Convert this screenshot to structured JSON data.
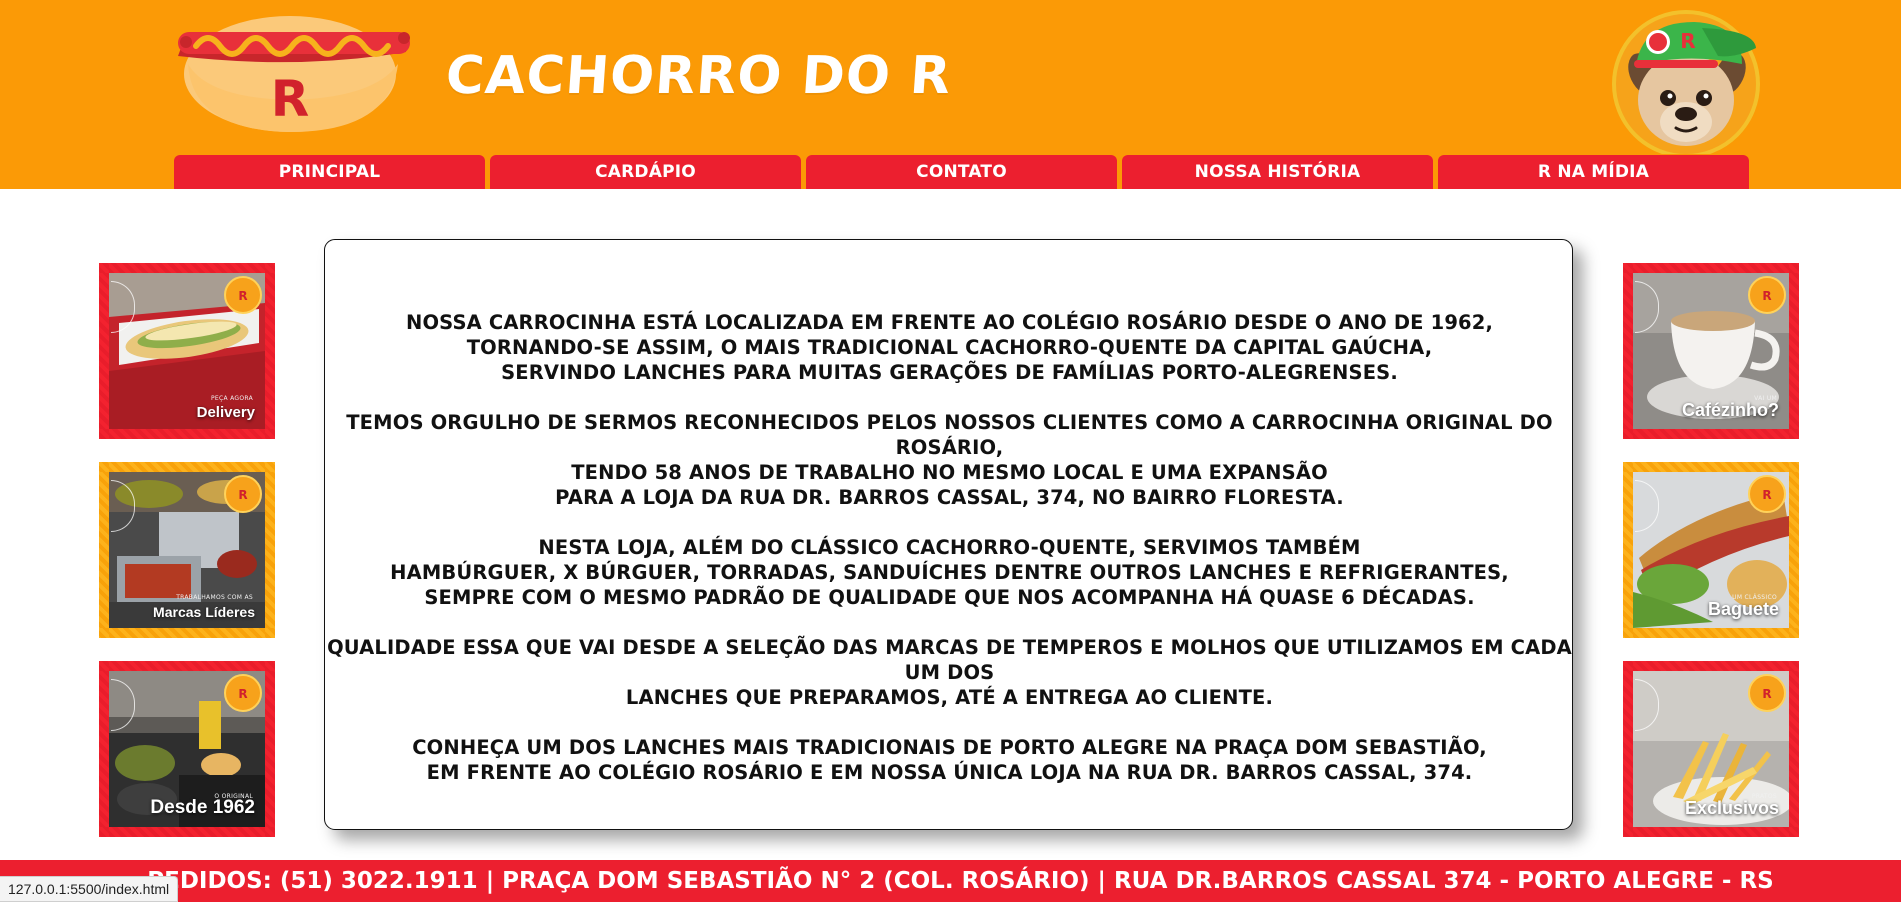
{
  "header": {
    "brand_title": "CACHORRO DO R",
    "logo_letter": "R",
    "mascot_cap_letter": "R"
  },
  "nav": {
    "items": [
      {
        "label": "PRINCIPAL"
      },
      {
        "label": "CARDÁPIO"
      },
      {
        "label": "CONTATO"
      },
      {
        "label": "NOSSA HISTÓRIA"
      },
      {
        "label": "R NA MÍDIA"
      }
    ]
  },
  "side_cards": {
    "left": [
      {
        "kicker": "PEÇA AGORA",
        "caption": "Delivery",
        "frame": "red"
      },
      {
        "kicker": "TRABALHAMOS COM AS",
        "caption": "Marcas Líderes",
        "frame": "orange"
      },
      {
        "kicker": "O ORIGINAL",
        "caption": "Desde 1962",
        "frame": "red"
      }
    ],
    "right": [
      {
        "kicker": "VAI UM",
        "caption": "Cafézinho?",
        "frame": "red"
      },
      {
        "kicker": "UM CLÁSSICO",
        "caption": "Baguete",
        "frame": "orange"
      },
      {
        "kicker": "PRATOS",
        "caption": "Exclusivos",
        "frame": "red"
      }
    ]
  },
  "main": {
    "paragraphs": [
      {
        "lines": [
          "NOSSA CARROCINHA ESTÁ LOCALIZADA EM FRENTE AO COLÉGIO ROSÁRIO DESDE O ANO DE 1962,",
          "TORNANDO-SE ASSIM, O MAIS TRADICIONAL CACHORRO-QUENTE DA CAPITAL GAÚCHA,",
          "SERVINDO LANCHES PARA MUITAS GERAÇÕES DE FAMÍLIAS PORTO-ALEGRENSES."
        ]
      },
      {
        "lines": [
          "TEMOS ORGULHO DE SERMOS RECONHECIDOS PELOS NOSSOS CLIENTES COMO A CARROCINHA ORIGINAL DO ROSÁRIO,",
          "TENDO 58 ANOS DE TRABALHO NO MESMO LOCAL E UMA EXPANSÃO",
          "PARA A LOJA DA RUA DR. BARROS CASSAL, 374, NO BAIRRO FLORESTA."
        ]
      },
      {
        "lines": [
          "NESTA LOJA, ALÉM DO CLÁSSICO CACHORRO-QUENTE, SERVIMOS TAMBÉM",
          "HAMBÚRGUER, X BÚRGUER, TORRADAS, SANDUÍCHES DENTRE OUTROS LANCHES E REFRIGERANTES,",
          "SEMPRE COM O MESMO PADRÃO DE QUALIDADE QUE NOS ACOMPANHA HÁ QUASE 6 DÉCADAS."
        ]
      },
      {
        "lines": [
          "QUALIDADE ESSA QUE VAI DESDE A SELEÇÃO DAS MARCAS DE TEMPEROS E MOLHOS QUE UTILIZAMOS EM CADA UM DOS",
          "LANCHES QUE PREPARAMOS, ATÉ A ENTREGA AO CLIENTE."
        ]
      },
      {
        "lines": [
          "CONHEÇA UM DOS LANCHES MAIS TRADICIONAIS DE PORTO ALEGRE NA PRAÇA DOM SEBASTIÃO,",
          "EM FRENTE AO COLÉGIO ROSÁRIO E EM NOSSA ÚNICA LOJA NA RUA DR. BARROS CASSAL, 374."
        ]
      }
    ]
  },
  "footer": {
    "text": "PEDIDOS: (51) 3022.1911 | PRAÇA DOM SEBASTIÃO N° 2 (COL. ROSÁRIO) | RUA DR.BARROS CASSAL 374 - PORTO ALEGRE - RS"
  },
  "statusbar": {
    "url": "127.0.0.1:5500/index.html"
  },
  "colors": {
    "header_orange": "#fb9a06",
    "brand_red": "#ec1f2f",
    "white": "#ffffff",
    "text_dark": "#111111"
  }
}
